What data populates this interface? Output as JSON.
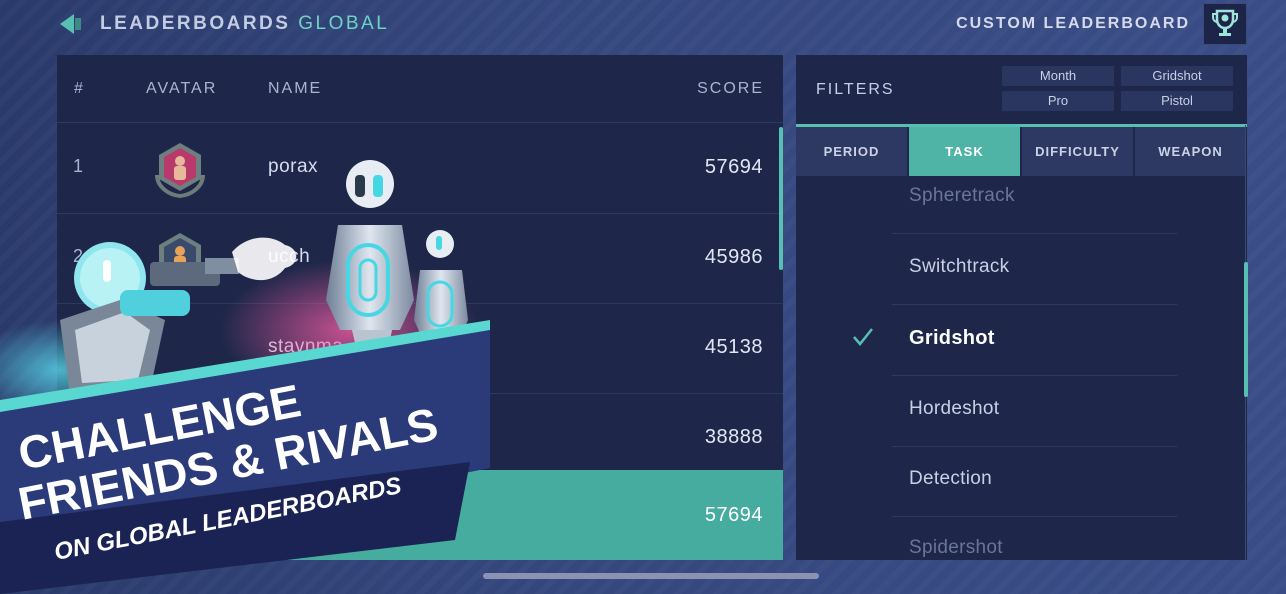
{
  "header": {
    "title_part1": "LEADERBOARDS",
    "title_part2": "GLOBAL",
    "custom_label": "CUSTOM LEADERBOARD"
  },
  "leaderboard": {
    "columns": {
      "rank": "#",
      "avatar": "AVATAR",
      "name": "NAME",
      "score": "SCORE"
    },
    "rows": [
      {
        "rank": "1",
        "name": "porax",
        "score": "57694"
      },
      {
        "rank": "2",
        "name": "ucch",
        "score": "45986"
      },
      {
        "rank": "",
        "name": "stavnma",
        "score": "45138"
      },
      {
        "rank": "",
        "name": "",
        "score": "38888"
      }
    ],
    "my_row": {
      "score": "57694"
    }
  },
  "filters": {
    "label": "FILTERS",
    "chips": [
      "Month",
      "Gridshot",
      "Pro",
      "Pistol"
    ],
    "tabs": [
      "PERIOD",
      "TASK",
      "DIFFICULTY",
      "WEAPON"
    ],
    "active_tab": "TASK",
    "options": [
      "Spheretrack",
      "Switchtrack",
      "Gridshot",
      "Hordeshot",
      "Detection",
      "Spidershot"
    ],
    "selected_option": "Gridshot"
  },
  "promo": {
    "line1": "CHALLENGE",
    "line2": "FRIENDS & RIVALS",
    "line3": "ON GLOBAL LEADERBOARDS"
  },
  "colors": {
    "accent": "#58c0b3",
    "panel": "#1e2749",
    "background": "#34477d",
    "highlight_row": "#47aca0"
  },
  "icons": [
    "back-arrow-icon",
    "trophy-icon",
    "checkmark-icon",
    "rank-badge-icon",
    "robot-character",
    "player-character"
  ]
}
